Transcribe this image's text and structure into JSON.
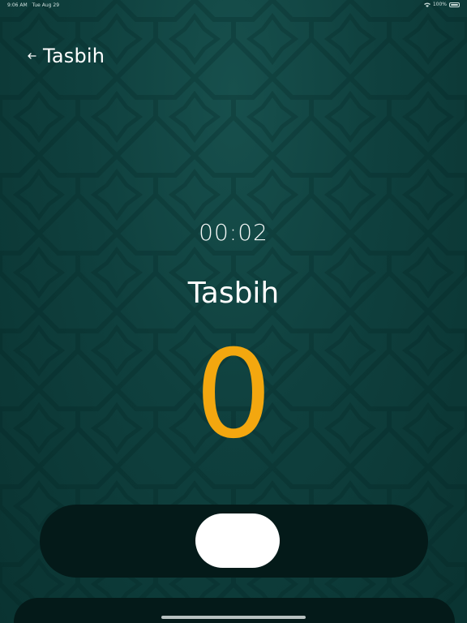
{
  "status_bar": {
    "time": "9:06 AM",
    "date": "Tue Aug 29",
    "battery": "100%"
  },
  "header": {
    "back_icon": "back-arrow-icon",
    "title": "Tasbih"
  },
  "timer": "00:02",
  "dhikr_name": "Tasbih",
  "counter": {
    "value": "0",
    "color": "#f3a70f"
  },
  "colors": {
    "background": "#0d3a39",
    "track": "#041a19",
    "knob": "#ffffff",
    "accent": "#f3a70f"
  }
}
